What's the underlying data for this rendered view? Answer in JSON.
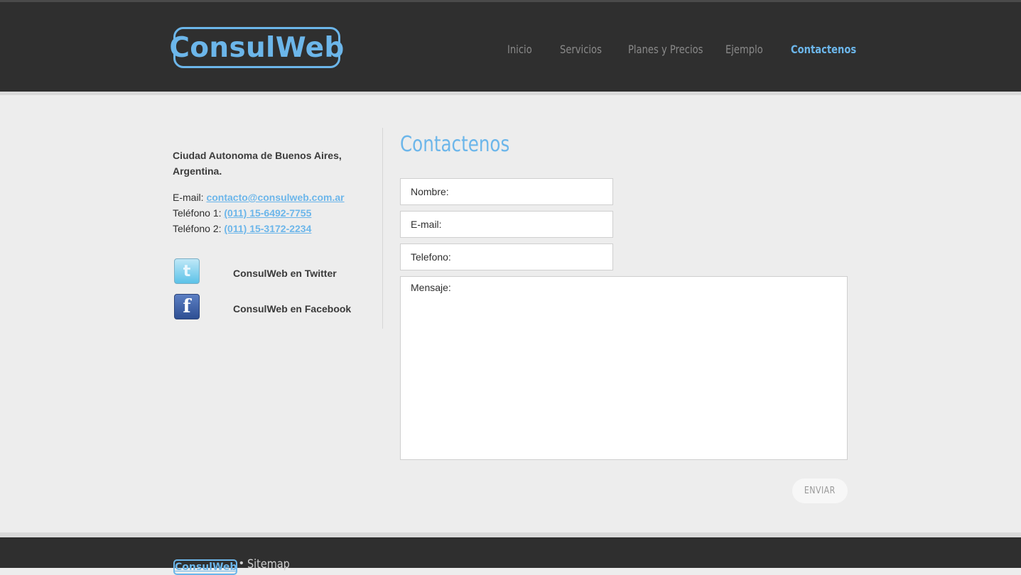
{
  "header": {
    "logo_text": "ConsulWeb",
    "nav": [
      {
        "label": "Inicio"
      },
      {
        "label": "Servicios"
      },
      {
        "label": "Planes y Precios"
      },
      {
        "label": "Ejemplo"
      },
      {
        "label": "Contactenos",
        "active": true
      }
    ]
  },
  "sidebar": {
    "address": "Ciudad Autonoma de Buenos Aires, Argentina.",
    "email_label": "E-mail:",
    "email": "contacto@consulweb.com.ar",
    "phone1_label": "Teléfono 1:",
    "phone1": "(011) 15-6492-7755",
    "phone2_label": "Teléfono 2:",
    "phone2": "(011) 15-3172-2234",
    "social": [
      {
        "icon": "twitter-icon",
        "label": "ConsulWeb en Twitter"
      },
      {
        "icon": "facebook-icon",
        "label": "ConsulWeb en Facebook"
      }
    ]
  },
  "form": {
    "title": "Contactenos",
    "name_placeholder": "Nombre:",
    "email_placeholder": "E-mail:",
    "phone_placeholder": "Telefono:",
    "message_placeholder": "Mensaje:",
    "submit_label": "ENVIAR"
  },
  "footer": {
    "logo_text": "ConsulWeb",
    "separator": "•",
    "sitemap_label": "Sitemap"
  },
  "colors": {
    "accent": "#6cb6ea",
    "header_bg": "#2f2f2f",
    "page_bg": "#ededed"
  }
}
